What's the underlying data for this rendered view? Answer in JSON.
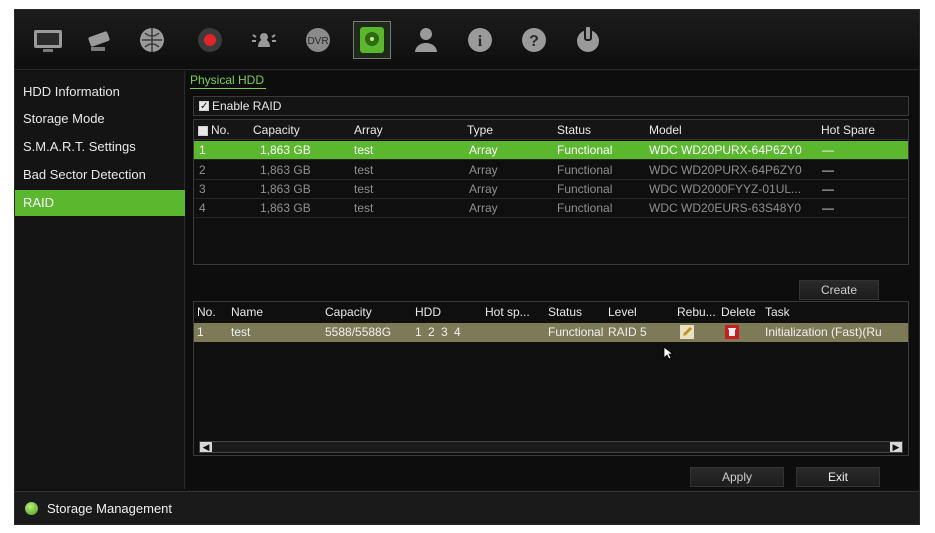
{
  "toolbar": {
    "icons": [
      "monitor-icon",
      "camera-icon",
      "network-icon",
      "record-icon",
      "alarm-icon",
      "device-icon",
      "hdd-icon",
      "user-icon",
      "info-icon",
      "help-icon",
      "power-icon"
    ],
    "active_icon": "hdd-icon"
  },
  "sidebar": {
    "items": [
      {
        "label": "HDD Information",
        "active": false
      },
      {
        "label": "Storage Mode",
        "active": false
      },
      {
        "label": "S.M.A.R.T. Settings",
        "active": false
      },
      {
        "label": "Bad Sector Detection",
        "active": false
      },
      {
        "label": "RAID",
        "active": true
      }
    ]
  },
  "main": {
    "tab": "Physical HDD",
    "enable_raid": {
      "label": "Enable RAID",
      "checked": true
    },
    "hdd_table": {
      "headers": [
        "No.",
        "Capacity",
        "Array",
        "Type",
        "Status",
        "Model",
        "Hot Spare"
      ],
      "rows": [
        {
          "no": "1",
          "capacity": "1,863 GB",
          "array": "test",
          "type": "Array",
          "status": "Functional",
          "model": "WDC WD20PURX-64P6ZY0",
          "hot_spare": "—",
          "selected": true
        },
        {
          "no": "2",
          "capacity": "1,863 GB",
          "array": "test",
          "type": "Array",
          "status": "Functional",
          "model": "WDC WD20PURX-64P6ZY0",
          "hot_spare": "—",
          "selected": false
        },
        {
          "no": "3",
          "capacity": "1,863 GB",
          "array": "test",
          "type": "Array",
          "status": "Functional",
          "model": "WDC WD2000FYYZ-01UL...",
          "hot_spare": "—",
          "selected": false
        },
        {
          "no": "4",
          "capacity": "1,863 GB",
          "array": "test",
          "type": "Array",
          "status": "Functional",
          "model": "WDC WD20EURS-63S48Y0",
          "hot_spare": "—",
          "selected": false
        }
      ]
    },
    "create_label": "Create",
    "array_table": {
      "headers": [
        "No.",
        "Name",
        "Capacity",
        "HDD",
        "Hot sp...",
        "Status",
        "Level",
        "Rebu...",
        "Delete",
        "Task"
      ],
      "rows": [
        {
          "no": "1",
          "name": "test",
          "capacity": "5588/5588G",
          "hdd": "1 2 3 4",
          "hot_spare": "",
          "status": "Functional",
          "level": "RAID 5",
          "task": "Initialization (Fast)(Ru"
        }
      ]
    },
    "apply_label": "Apply",
    "exit_label": "Exit"
  },
  "statusbar": {
    "label": "Storage Management"
  }
}
